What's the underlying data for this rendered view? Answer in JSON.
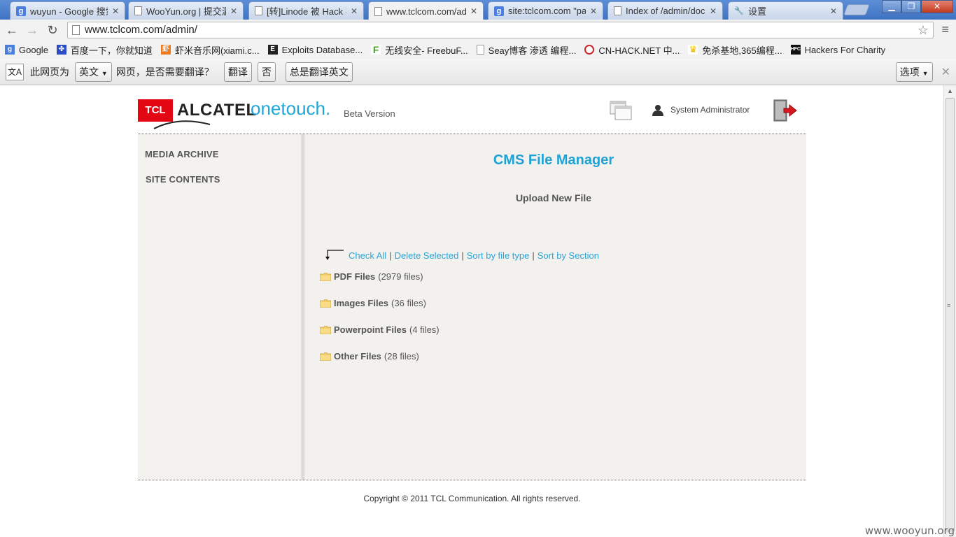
{
  "browser": {
    "tabs": [
      {
        "title": "wuyun - Google 搜索",
        "favicon": "google-favicon"
      },
      {
        "title": "WooYun.org | 提交漏洞",
        "favicon": "page-favicon"
      },
      {
        "title": "[转]Linode 被 Hack 事",
        "favicon": "page-favicon"
      },
      {
        "title": "www.tclcom.com/adm",
        "favicon": "page-favicon",
        "active": true
      },
      {
        "title": "site:tclcom.com \"par",
        "favicon": "google-favicon"
      },
      {
        "title": "Index of /admin/doc",
        "favicon": "page-favicon"
      },
      {
        "title": "设置",
        "favicon": "wrench-favicon"
      }
    ],
    "url": "www.tclcom.com/admin/",
    "bookmarks": [
      {
        "label": "Google",
        "color": "#4a7fe0",
        "glyph": "g"
      },
      {
        "label": "百度一下，你就知道",
        "color": "#2c4cc4",
        "glyph": "🐾"
      },
      {
        "label": "虾米音乐网(xiami.c...",
        "color": "#f07a1a",
        "glyph": "虾"
      },
      {
        "label": "Exploits Database...",
        "color": "#222222",
        "glyph": "E"
      },
      {
        "label": "无线安全- FreebuF...",
        "color": "#4aa02c",
        "glyph": "F"
      },
      {
        "label": "Seay博客 渗透 编程...",
        "color": "#999999",
        "glyph": ""
      },
      {
        "label": "CN-HACK.NET 中...",
        "color": "#d0242c",
        "glyph": "C"
      },
      {
        "label": "免杀基地,365编程...",
        "color": "#e6b800",
        "glyph": "♛"
      },
      {
        "label": "Hackers For Charity",
        "color": "#111111",
        "glyph": "H"
      }
    ],
    "translate": {
      "prefix": "此网页为",
      "language": "英文",
      "question": "网页，是否需要翻译？",
      "translate_btn": "翻译",
      "no_btn": "否",
      "always_btn": "总是翻译英文",
      "options_btn": "选项"
    }
  },
  "site": {
    "brand_tcl": "TCL",
    "brand_alcatel": "ALCATEL",
    "brand_onetouch": "onetouch.",
    "beta": "Beta Version",
    "user": "System Administrator"
  },
  "sidebar": {
    "items": [
      {
        "label": "MEDIA ARCHIVE"
      },
      {
        "label": "SITE CONTENTS"
      }
    ]
  },
  "main": {
    "title": "CMS File Manager",
    "subtitle": "Upload New File",
    "actions": [
      "Check All",
      "Delete Selected",
      "Sort by file type",
      "Sort by Section"
    ],
    "folders": [
      {
        "name": "PDF Files",
        "count": "(2979 files)"
      },
      {
        "name": "Images Files",
        "count": "(36 files)"
      },
      {
        "name": "Powerpoint Files",
        "count": "(4 files)"
      },
      {
        "name": "Other Files",
        "count": "(28 files)"
      }
    ]
  },
  "footer": "Copyright © 2011 TCL Communication. All rights reserved.",
  "watermark": "www.wooyun.org",
  "colors": {
    "accent": "#1fa2d6",
    "brand_red": "#e30613",
    "link": "#2aa4d6"
  }
}
